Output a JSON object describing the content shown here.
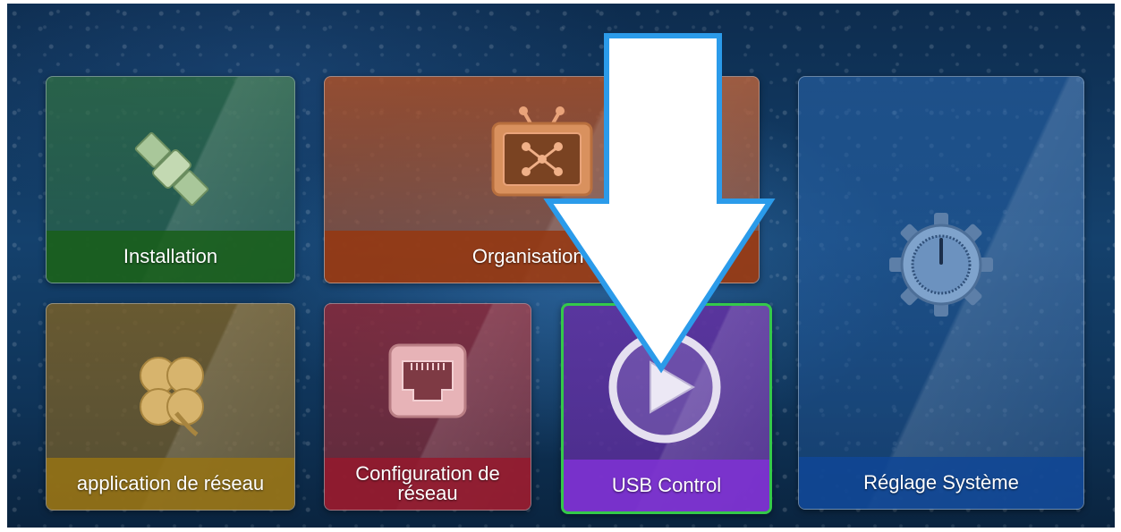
{
  "menu": {
    "tiles": [
      {
        "label": "Installation",
        "icon": "satellite-icon",
        "color": "#1f6b23"
      },
      {
        "label": "Organisation du",
        "icon": "tv-icon",
        "color": "#963a12"
      },
      {
        "label": "Réglage Système",
        "icon": "gear-power-icon",
        "color": "#124a96"
      },
      {
        "label": "application de réseau",
        "icon": "clover-icon",
        "color": "#967314"
      },
      {
        "label": "Configuration de réseau",
        "icon": "ethernet-port-icon",
        "color": "#96192d"
      },
      {
        "label": "USB Control",
        "icon": "play-circle-icon",
        "color": "#7d32d2"
      }
    ],
    "selected": "USB Control",
    "selection_color": "#34c94a"
  },
  "annotation": {
    "icon": "down-arrow-icon",
    "color": "#ffffff",
    "outline": "#2b9bea"
  }
}
